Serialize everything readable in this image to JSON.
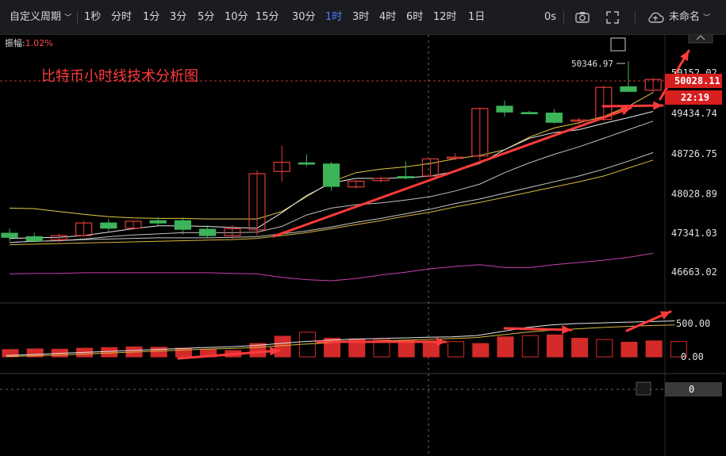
{
  "toolbar": {
    "custom_period": "自定义周期",
    "intervals": [
      "1秒",
      "分时",
      "1分",
      "3分",
      "5分",
      "10分",
      "15分",
      "30分",
      "1时",
      "3时",
      "4时",
      "6时",
      "12时",
      "1日"
    ],
    "active_interval": "1时",
    "right_label": "0s",
    "layout_name": "未命名"
  },
  "amplitude": {
    "label": "振幅:",
    "value": "1.02%"
  },
  "annotation_title": "比特币小时线技术分析图",
  "colors": {
    "up": "#e23b3b",
    "down": "#3cb45a",
    "accent": "#ff3b3b",
    "active": "#4c7dff"
  },
  "chart_data": {
    "type": "candlestick",
    "price_axis": {
      "ticks": [
        "49434.74",
        "48726.75",
        "48028.89",
        "47341.03",
        "46663.02"
      ],
      "tick_values": [
        49434.74,
        48726.75,
        48028.89,
        47341.03,
        46663.02
      ],
      "top_partial": "50152.02",
      "current_price": "50028.11",
      "countdown": "22:19",
      "high_marker": "50346.97"
    },
    "volume_axis": {
      "ticks": [
        "500.00",
        "0.00"
      ]
    },
    "indicator_axis": {
      "value": "0"
    },
    "candles": [
      {
        "o": 47340,
        "h": 47420,
        "l": 47200,
        "c": 47270
      },
      {
        "o": 47280,
        "h": 47350,
        "l": 47190,
        "c": 47210
      },
      {
        "o": 47230,
        "h": 47330,
        "l": 47180,
        "c": 47300
      },
      {
        "o": 47300,
        "h": 47560,
        "l": 47280,
        "c": 47520
      },
      {
        "o": 47520,
        "h": 47590,
        "l": 47380,
        "c": 47430
      },
      {
        "o": 47430,
        "h": 47560,
        "l": 47400,
        "c": 47550
      },
      {
        "o": 47560,
        "h": 47620,
        "l": 47470,
        "c": 47520
      },
      {
        "o": 47560,
        "h": 47620,
        "l": 47320,
        "c": 47410
      },
      {
        "o": 47410,
        "h": 47480,
        "l": 47260,
        "c": 47300
      },
      {
        "o": 47300,
        "h": 47480,
        "l": 47240,
        "c": 47420
      },
      {
        "o": 47400,
        "h": 48440,
        "l": 47300,
        "c": 48380
      },
      {
        "o": 48420,
        "h": 48870,
        "l": 48240,
        "c": 48580
      },
      {
        "o": 48570,
        "h": 48720,
        "l": 48510,
        "c": 48550
      },
      {
        "o": 48550,
        "h": 48590,
        "l": 48080,
        "c": 48160
      },
      {
        "o": 48150,
        "h": 48270,
        "l": 48120,
        "c": 48250
      },
      {
        "o": 48260,
        "h": 48330,
        "l": 48230,
        "c": 48300
      },
      {
        "o": 48330,
        "h": 48600,
        "l": 48280,
        "c": 48320
      },
      {
        "o": 48340,
        "h": 48650,
        "l": 48310,
        "c": 48640
      },
      {
        "o": 48650,
        "h": 48740,
        "l": 48620,
        "c": 48670
      },
      {
        "o": 48690,
        "h": 49540,
        "l": 48610,
        "c": 49520
      },
      {
        "o": 49560,
        "h": 49660,
        "l": 49380,
        "c": 49460
      },
      {
        "o": 49450,
        "h": 49480,
        "l": 49420,
        "c": 49430
      },
      {
        "o": 49440,
        "h": 49510,
        "l": 49260,
        "c": 49280
      },
      {
        "o": 49300,
        "h": 49360,
        "l": 49240,
        "c": 49320
      },
      {
        "o": 49330,
        "h": 49920,
        "l": 49300,
        "c": 49890
      },
      {
        "o": 49900,
        "h": 50346.97,
        "l": 49820,
        "c": 49820
      },
      {
        "o": 49840,
        "h": 50060,
        "l": 49800,
        "c": 50028.11
      }
    ],
    "ma_lines": [
      {
        "color": "#e6c94a",
        "values": [
          47780,
          47770,
          47720,
          47670,
          47630,
          47610,
          47600,
          47600,
          47590,
          47590,
          47590,
          47720,
          47980,
          48240,
          48400,
          48460,
          48500,
          48560,
          48640,
          48700,
          48800,
          49020,
          49180,
          49270,
          49380,
          49560,
          49800
        ]
      },
      {
        "color": "#e8e8e8",
        "values": [
          47250,
          47260,
          47270,
          47300,
          47360,
          47420,
          47470,
          47470,
          47460,
          47440,
          47430,
          47700,
          48000,
          48220,
          48300,
          48300,
          48310,
          48340,
          48420,
          48560,
          48800,
          49000,
          49100,
          49150,
          49260,
          49360,
          49470
        ]
      },
      {
        "color": "#bfbfbf",
        "values": [
          47180,
          47200,
          47210,
          47240,
          47280,
          47310,
          47330,
          47350,
          47350,
          47350,
          47360,
          47460,
          47660,
          47780,
          47840,
          47870,
          47920,
          47980,
          48080,
          48200,
          48400,
          48570,
          48720,
          48850,
          49000,
          49150,
          49300
        ]
      },
      {
        "color": "#c8c8c8",
        "values": [
          47180,
          47200,
          47210,
          47230,
          47240,
          47250,
          47260,
          47260,
          47260,
          47270,
          47280,
          47330,
          47380,
          47450,
          47530,
          47600,
          47680,
          47760,
          47860,
          47940,
          48040,
          48140,
          48240,
          48340,
          48460,
          48600,
          48750
        ]
      },
      {
        "color": "#d8b63c",
        "values": [
          47140,
          47150,
          47160,
          47170,
          47180,
          47190,
          47200,
          47210,
          47220,
          47230,
          47250,
          47300,
          47350,
          47420,
          47490,
          47560,
          47640,
          47710,
          47800,
          47880,
          47970,
          48060,
          48150,
          48240,
          48340,
          48480,
          48620
        ]
      },
      {
        "color": "#c93fae",
        "values": [
          46630,
          46640,
          46640,
          46650,
          46650,
          46650,
          46650,
          46650,
          46650,
          46640,
          46630,
          46570,
          46530,
          46510,
          46550,
          46610,
          46660,
          46720,
          46760,
          46790,
          46740,
          46740,
          46790,
          46830,
          46870,
          46920,
          46990
        ]
      }
    ],
    "volumes": [
      110,
      120,
      115,
      130,
      140,
      150,
      145,
      130,
      110,
      95,
      200,
      310,
      370,
      280,
      270,
      260,
      250,
      240,
      230,
      200,
      300,
      320,
      330,
      280,
      260,
      220,
      240,
      230
    ],
    "volume_ma": [
      {
        "color": "#e6e6e6",
        "values": [
          20,
          35,
          50,
          65,
          80,
          95,
          110,
          125,
          140,
          150,
          170,
          200,
          230,
          250,
          265,
          275,
          285,
          295,
          300,
          320,
          380,
          440,
          480,
          500,
          510,
          520,
          530,
          540
        ]
      },
      {
        "color": "#d8b63c",
        "values": [
          5,
          15,
          25,
          40,
          55,
          70,
          85,
          100,
          115,
          125,
          140,
          165,
          190,
          210,
          225,
          240,
          250,
          262,
          275,
          290,
          330,
          370,
          400,
          420,
          440,
          455,
          470,
          480
        ]
      }
    ]
  }
}
